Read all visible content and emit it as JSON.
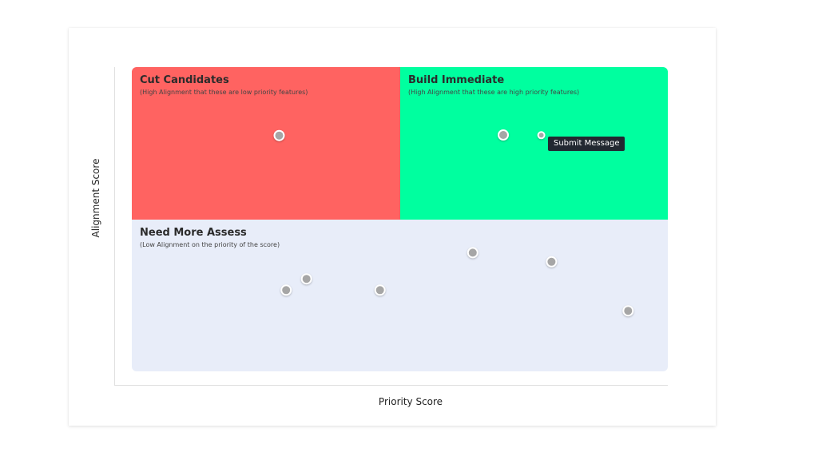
{
  "chart_data": {
    "type": "scatter",
    "xlabel": "Priority Score",
    "ylabel": "Alignment Score",
    "xlim": [
      0,
      100
    ],
    "ylim": [
      0,
      100
    ],
    "grid": false,
    "quadrants": [
      {
        "key": "top-left",
        "title": "Cut Candidates",
        "subtitle": "(High Alignment that these are low priority features)",
        "color": "#ff6361"
      },
      {
        "key": "top-right",
        "title": "Build Immediate",
        "subtitle": "(High Alignment that these are high priority features)",
        "color": "#00ff9f"
      },
      {
        "key": "bottom",
        "title": "Need More Assess",
        "subtitle": "(Low Alignment on the priority of the score)",
        "color": "#e8edf9"
      }
    ],
    "points": [
      {
        "x": 27.5,
        "y": 77.5
      },
      {
        "x": 69.3,
        "y": 77.7
      },
      {
        "x": 76.4,
        "y": 77.6,
        "hovered": true
      },
      {
        "x": 63.6,
        "y": 39.0
      },
      {
        "x": 78.3,
        "y": 36.0
      },
      {
        "x": 28.8,
        "y": 26.7
      },
      {
        "x": 32.6,
        "y": 30.4
      },
      {
        "x": 46.3,
        "y": 26.7
      },
      {
        "x": 92.6,
        "y": 19.9
      }
    ],
    "point_color": "#a6a6a6",
    "point_stroke": "#ffffff"
  },
  "tooltip": {
    "text": "Submit Message"
  }
}
